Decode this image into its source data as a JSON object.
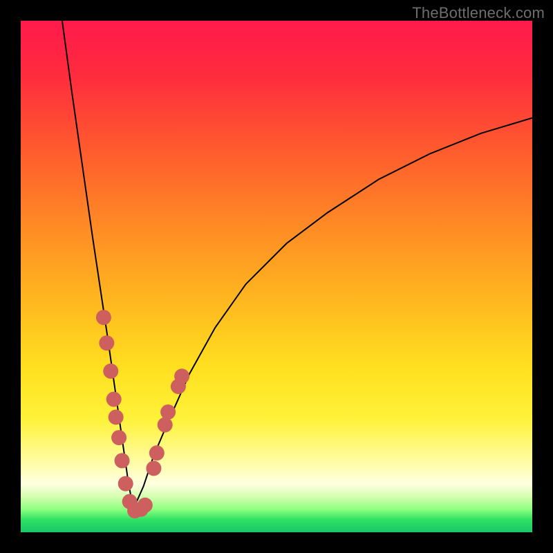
{
  "watermark": "TheBottleneck.com",
  "colors": {
    "frame": "#000000",
    "curve": "#000000",
    "dots": "#cd5f5f",
    "gradient_stops": [
      {
        "offset": 0.0,
        "color": "#ff1a4b"
      },
      {
        "offset": 0.1,
        "color": "#ff2a3f"
      },
      {
        "offset": 0.25,
        "color": "#ff5a2e"
      },
      {
        "offset": 0.4,
        "color": "#ff8a25"
      },
      {
        "offset": 0.55,
        "color": "#ffb81f"
      },
      {
        "offset": 0.68,
        "color": "#ffe01f"
      },
      {
        "offset": 0.78,
        "color": "#fff23a"
      },
      {
        "offset": 0.86,
        "color": "#fffca0"
      },
      {
        "offset": 0.905,
        "color": "#ffffe0"
      },
      {
        "offset": 0.93,
        "color": "#d6ffb0"
      },
      {
        "offset": 0.955,
        "color": "#8eff80"
      },
      {
        "offset": 0.975,
        "color": "#30e264"
      },
      {
        "offset": 1.0,
        "color": "#18c767"
      }
    ]
  },
  "chart_data": {
    "type": "line",
    "title": "",
    "xlabel": "",
    "ylabel": "",
    "xlim": [
      0,
      100
    ],
    "ylim": [
      0,
      100
    ],
    "note": "Axes are unlabeled; values are read as pixel-percent of the 740×740 plot area. The curve is a V-shaped bottleneck trace with minimum near x≈22, y≈4. Left branch descends steeply from (x≈8, y≈100); right branch rises toward (x≈100, y≈81). Circular markers cluster along both branches near the trough.",
    "series": [
      {
        "name": "bottleneck-curve-left",
        "x": [
          8.1,
          10.0,
          12.0,
          14.0,
          15.5,
          17.0,
          18.0,
          19.0,
          20.0,
          21.0,
          22.0
        ],
        "y": [
          100.0,
          86.0,
          72.0,
          58.0,
          48.0,
          38.0,
          31.0,
          24.0,
          17.0,
          10.0,
          4.5
        ]
      },
      {
        "name": "bottleneck-curve-right",
        "x": [
          22.0,
          24.0,
          26.0,
          29.0,
          33.0,
          38.0,
          44.0,
          52.0,
          60.0,
          70.0,
          80.0,
          90.0,
          100.0
        ],
        "y": [
          4.5,
          9.0,
          15.0,
          22.0,
          31.0,
          40.0,
          48.5,
          56.5,
          62.5,
          69.0,
          74.0,
          78.0,
          81.0
        ]
      }
    ],
    "markers": [
      {
        "x": 16.2,
        "y": 42.0
      },
      {
        "x": 16.8,
        "y": 37.0
      },
      {
        "x": 17.6,
        "y": 31.5
      },
      {
        "x": 18.2,
        "y": 26.0
      },
      {
        "x": 18.6,
        "y": 22.5
      },
      {
        "x": 19.2,
        "y": 18.5
      },
      {
        "x": 19.8,
        "y": 14.0
      },
      {
        "x": 20.5,
        "y": 9.5
      },
      {
        "x": 21.3,
        "y": 6.0
      },
      {
        "x": 22.3,
        "y": 4.2
      },
      {
        "x": 23.5,
        "y": 4.5
      },
      {
        "x": 24.3,
        "y": 5.3
      },
      {
        "x": 26.0,
        "y": 12.5
      },
      {
        "x": 26.6,
        "y": 15.5
      },
      {
        "x": 28.2,
        "y": 21.0
      },
      {
        "x": 28.8,
        "y": 23.5
      },
      {
        "x": 30.8,
        "y": 28.5
      },
      {
        "x": 31.5,
        "y": 30.5
      }
    ]
  }
}
